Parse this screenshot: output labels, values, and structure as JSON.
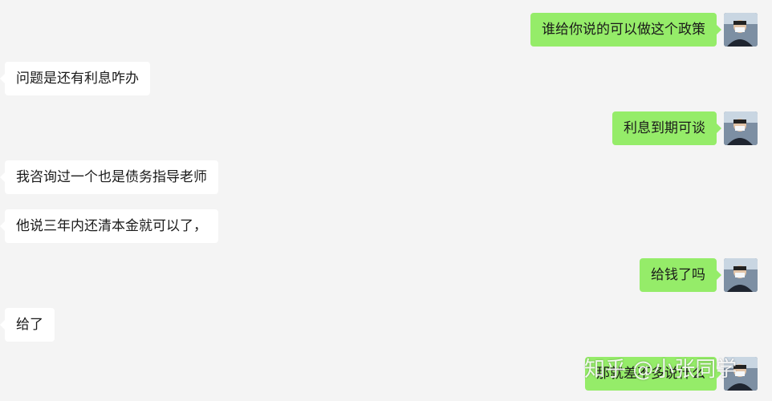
{
  "messages": [
    {
      "side": "out",
      "text": "谁给你说的可以做这个政策"
    },
    {
      "side": "in",
      "text": "问题是还有利息咋办"
    },
    {
      "side": "out",
      "text": "利息到期可谈"
    },
    {
      "side": "in",
      "text": "我咨询过一个也是债务指导老师"
    },
    {
      "side": "in",
      "text": "他说三年内还清本金就可以了，"
    },
    {
      "side": "out",
      "text": "给钱了吗"
    },
    {
      "side": "in",
      "text": "给了"
    },
    {
      "side": "out",
      "text": "那就差不多说什么"
    }
  ],
  "avatar_icon": "user-avatar-icon",
  "watermark": "知乎 @小张同学"
}
